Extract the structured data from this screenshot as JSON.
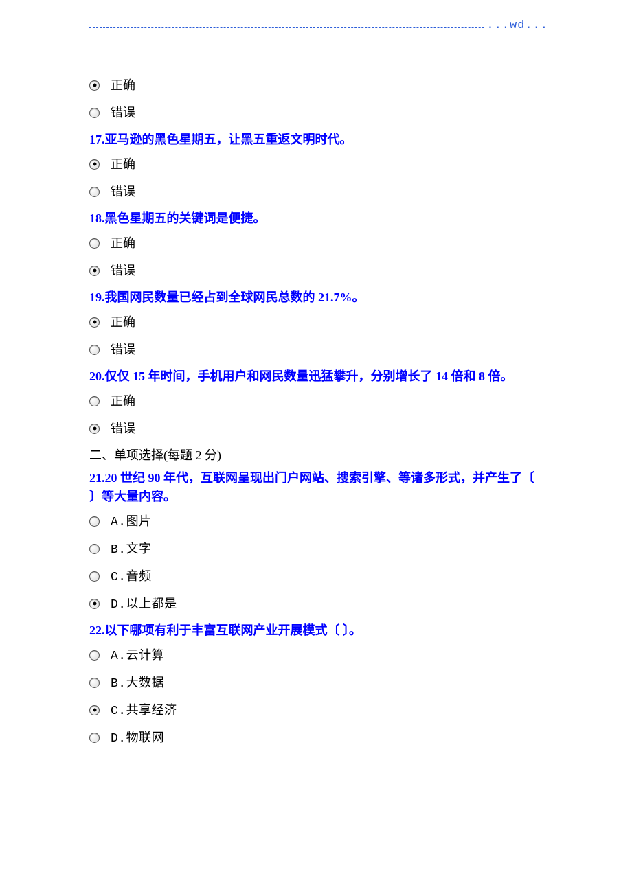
{
  "header": {
    "wd": "...wd..."
  },
  "q16": {
    "opt_true": {
      "label": "正确",
      "selected": true
    },
    "opt_false": {
      "label": "错误",
      "selected": false
    }
  },
  "q17": {
    "text": "17.亚马逊的黑色星期五，让黑五重返文明时代。",
    "opt_true": {
      "label": "正确",
      "selected": true
    },
    "opt_false": {
      "label": "错误",
      "selected": false
    }
  },
  "q18": {
    "text": "18.黑色星期五的关键词是便捷。",
    "opt_true": {
      "label": "正确",
      "selected": false
    },
    "opt_false": {
      "label": "错误",
      "selected": true
    }
  },
  "q19": {
    "text": "19.我国网民数量已经占到全球网民总数的 21.7%。",
    "opt_true": {
      "label": "正确",
      "selected": true
    },
    "opt_false": {
      "label": "错误",
      "selected": false
    }
  },
  "q20": {
    "text": "20.仅仅 15 年时间，手机用户和网民数量迅猛攀升，分别增长了 14 倍和 8 倍。",
    "opt_true": {
      "label": "正确",
      "selected": false
    },
    "opt_false": {
      "label": "错误",
      "selected": true
    }
  },
  "section2": {
    "title": "二、单项选择(每题 2 分)"
  },
  "q21": {
    "text": "21.20 世纪 90 年代，互联网呈现出门户网站、搜索引擎、等诸多形式，并产生了〔 〕等大量内容。",
    "a": {
      "label": "A.图片",
      "selected": false
    },
    "b": {
      "label": "B.文字",
      "selected": false
    },
    "c": {
      "label": "C.音频",
      "selected": false
    },
    "d": {
      "label": "D.以上都是",
      "selected": true
    }
  },
  "q22": {
    "text": "22.以下哪项有利于丰富互联网产业开展模式〔 〕。",
    "a": {
      "label": "A.云计算",
      "selected": false
    },
    "b": {
      "label": "B.大数据",
      "selected": false
    },
    "c": {
      "label": "C.共享经济",
      "selected": true
    },
    "d": {
      "label": "D.物联网",
      "selected": false
    }
  }
}
